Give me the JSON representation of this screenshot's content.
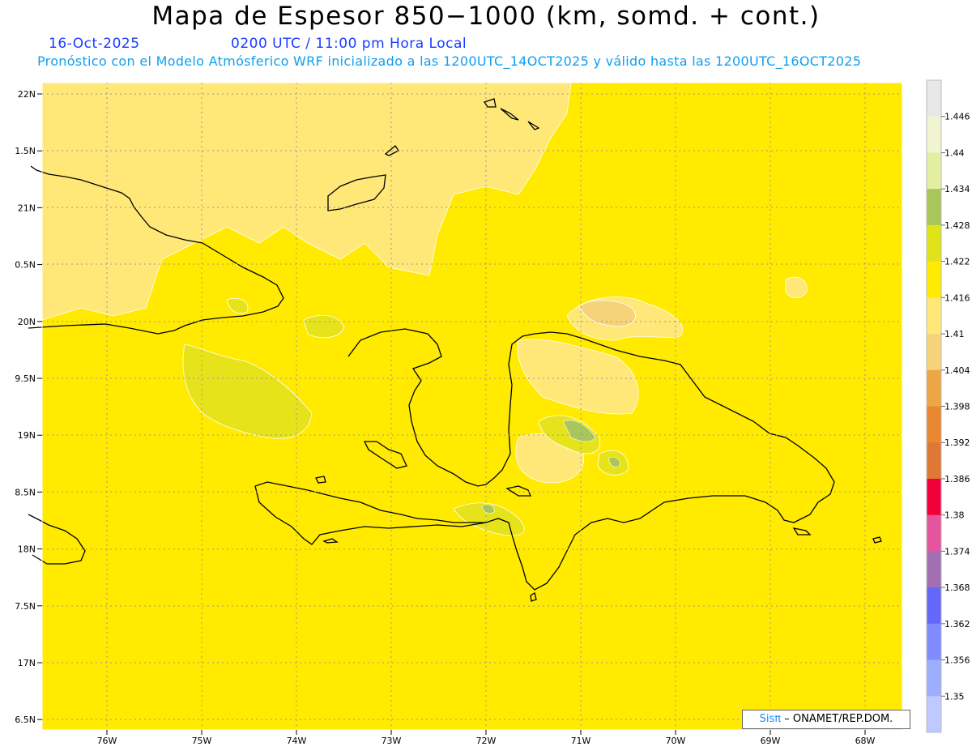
{
  "header": {
    "title": "Mapa de Espesor 850−1000 (km, somd. + cont.)",
    "date": "16-Oct-2025",
    "time": "0200 UTC / 11:00 pm Hora Local",
    "subtitle": "Pronóstico con el Modelo Atmósferico WRF inicializado a las 1200UTC_14OCT2025 y válido hasta las  1200UTC_16OCT2025"
  },
  "map": {
    "lat_labels": [
      "22N",
      "1.5N",
      "21N",
      "0.5N",
      "20N",
      "9.5N",
      "19N",
      "8.5N",
      "18N",
      "7.5N",
      "17N",
      "6.5N"
    ],
    "lon_labels": [
      "76W",
      "75W",
      "74W",
      "73W",
      "72W",
      "71W",
      "70W",
      "69W",
      "68W"
    ],
    "background_value_color": "#ffea00",
    "lighter_tone_color": "#ffe878",
    "greenish_tone_color": "#e6e31a"
  },
  "colorbar": {
    "levels": [
      "1.446",
      "1.44",
      "1.434",
      "1.428",
      "1.422",
      "1.416",
      "1.41",
      "1.404",
      "1.398",
      "1.392",
      "1.386",
      "1.38",
      "1.374",
      "1.368",
      "1.362",
      "1.356",
      "1.35"
    ],
    "colors": [
      "#e8e8e8",
      "#f0f5d0",
      "#e2eea0",
      "#a9c65a",
      "#e1e31a",
      "#ffea00",
      "#ffe878",
      "#f6d27a",
      "#eda646",
      "#e88832",
      "#de7834",
      "#f2003a",
      "#e5559e",
      "#a270b2",
      "#6368fa",
      "#7f8cff",
      "#9eaeff",
      "#bfc8ff"
    ]
  },
  "credit": {
    "sis": "Sisπ",
    "text": "– ONAMET/REP.DOM."
  }
}
